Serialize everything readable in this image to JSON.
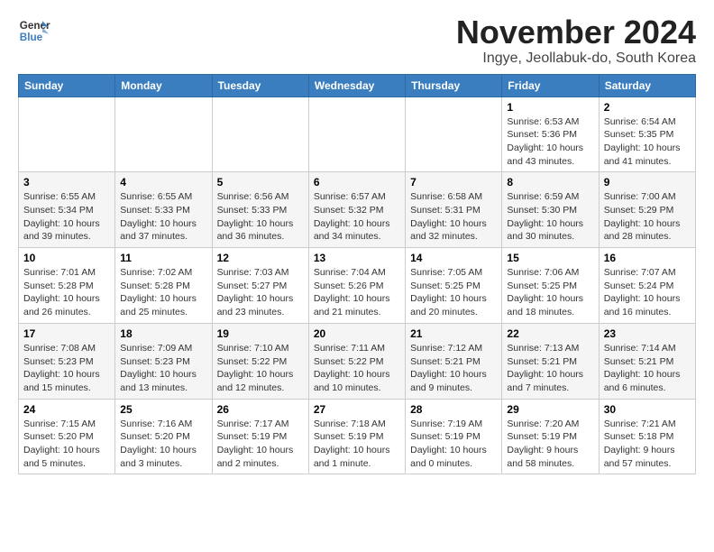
{
  "header": {
    "logo_line1": "General",
    "logo_line2": "Blue",
    "month": "November 2024",
    "location": "Ingye, Jeollabuk-do, South Korea"
  },
  "weekdays": [
    "Sunday",
    "Monday",
    "Tuesday",
    "Wednesday",
    "Thursday",
    "Friday",
    "Saturday"
  ],
  "weeks": [
    [
      {
        "day": "",
        "detail": ""
      },
      {
        "day": "",
        "detail": ""
      },
      {
        "day": "",
        "detail": ""
      },
      {
        "day": "",
        "detail": ""
      },
      {
        "day": "",
        "detail": ""
      },
      {
        "day": "1",
        "detail": "Sunrise: 6:53 AM\nSunset: 5:36 PM\nDaylight: 10 hours and 43 minutes."
      },
      {
        "day": "2",
        "detail": "Sunrise: 6:54 AM\nSunset: 5:35 PM\nDaylight: 10 hours and 41 minutes."
      }
    ],
    [
      {
        "day": "3",
        "detail": "Sunrise: 6:55 AM\nSunset: 5:34 PM\nDaylight: 10 hours and 39 minutes."
      },
      {
        "day": "4",
        "detail": "Sunrise: 6:55 AM\nSunset: 5:33 PM\nDaylight: 10 hours and 37 minutes."
      },
      {
        "day": "5",
        "detail": "Sunrise: 6:56 AM\nSunset: 5:33 PM\nDaylight: 10 hours and 36 minutes."
      },
      {
        "day": "6",
        "detail": "Sunrise: 6:57 AM\nSunset: 5:32 PM\nDaylight: 10 hours and 34 minutes."
      },
      {
        "day": "7",
        "detail": "Sunrise: 6:58 AM\nSunset: 5:31 PM\nDaylight: 10 hours and 32 minutes."
      },
      {
        "day": "8",
        "detail": "Sunrise: 6:59 AM\nSunset: 5:30 PM\nDaylight: 10 hours and 30 minutes."
      },
      {
        "day": "9",
        "detail": "Sunrise: 7:00 AM\nSunset: 5:29 PM\nDaylight: 10 hours and 28 minutes."
      }
    ],
    [
      {
        "day": "10",
        "detail": "Sunrise: 7:01 AM\nSunset: 5:28 PM\nDaylight: 10 hours and 26 minutes."
      },
      {
        "day": "11",
        "detail": "Sunrise: 7:02 AM\nSunset: 5:28 PM\nDaylight: 10 hours and 25 minutes."
      },
      {
        "day": "12",
        "detail": "Sunrise: 7:03 AM\nSunset: 5:27 PM\nDaylight: 10 hours and 23 minutes."
      },
      {
        "day": "13",
        "detail": "Sunrise: 7:04 AM\nSunset: 5:26 PM\nDaylight: 10 hours and 21 minutes."
      },
      {
        "day": "14",
        "detail": "Sunrise: 7:05 AM\nSunset: 5:25 PM\nDaylight: 10 hours and 20 minutes."
      },
      {
        "day": "15",
        "detail": "Sunrise: 7:06 AM\nSunset: 5:25 PM\nDaylight: 10 hours and 18 minutes."
      },
      {
        "day": "16",
        "detail": "Sunrise: 7:07 AM\nSunset: 5:24 PM\nDaylight: 10 hours and 16 minutes."
      }
    ],
    [
      {
        "day": "17",
        "detail": "Sunrise: 7:08 AM\nSunset: 5:23 PM\nDaylight: 10 hours and 15 minutes."
      },
      {
        "day": "18",
        "detail": "Sunrise: 7:09 AM\nSunset: 5:23 PM\nDaylight: 10 hours and 13 minutes."
      },
      {
        "day": "19",
        "detail": "Sunrise: 7:10 AM\nSunset: 5:22 PM\nDaylight: 10 hours and 12 minutes."
      },
      {
        "day": "20",
        "detail": "Sunrise: 7:11 AM\nSunset: 5:22 PM\nDaylight: 10 hours and 10 minutes."
      },
      {
        "day": "21",
        "detail": "Sunrise: 7:12 AM\nSunset: 5:21 PM\nDaylight: 10 hours and 9 minutes."
      },
      {
        "day": "22",
        "detail": "Sunrise: 7:13 AM\nSunset: 5:21 PM\nDaylight: 10 hours and 7 minutes."
      },
      {
        "day": "23",
        "detail": "Sunrise: 7:14 AM\nSunset: 5:21 PM\nDaylight: 10 hours and 6 minutes."
      }
    ],
    [
      {
        "day": "24",
        "detail": "Sunrise: 7:15 AM\nSunset: 5:20 PM\nDaylight: 10 hours and 5 minutes."
      },
      {
        "day": "25",
        "detail": "Sunrise: 7:16 AM\nSunset: 5:20 PM\nDaylight: 10 hours and 3 minutes."
      },
      {
        "day": "26",
        "detail": "Sunrise: 7:17 AM\nSunset: 5:19 PM\nDaylight: 10 hours and 2 minutes."
      },
      {
        "day": "27",
        "detail": "Sunrise: 7:18 AM\nSunset: 5:19 PM\nDaylight: 10 hours and 1 minute."
      },
      {
        "day": "28",
        "detail": "Sunrise: 7:19 AM\nSunset: 5:19 PM\nDaylight: 10 hours and 0 minutes."
      },
      {
        "day": "29",
        "detail": "Sunrise: 7:20 AM\nSunset: 5:19 PM\nDaylight: 9 hours and 58 minutes."
      },
      {
        "day": "30",
        "detail": "Sunrise: 7:21 AM\nSunset: 5:18 PM\nDaylight: 9 hours and 57 minutes."
      }
    ]
  ]
}
